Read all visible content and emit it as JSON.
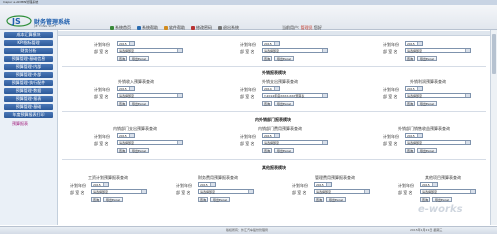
{
  "window": {
    "title": "Inspur e-ADMIN管理系统"
  },
  "app": {
    "logo_text": "财务管理系统",
    "logo_sub": "JIE TONG SOFT"
  },
  "topnav": [
    {
      "label": "系统首页",
      "color": "#3a8a3a"
    },
    {
      "label": "系统帮助",
      "color": "#2b6cb0"
    },
    {
      "label": "软件帮助",
      "color": "#d18b1f"
    },
    {
      "label": "修改密码",
      "color": "#b83232"
    },
    {
      "label": "退出系统",
      "color": "#777777"
    }
  ],
  "user": {
    "greeting": "当前用户:",
    "name": "管理员",
    "role": "您好"
  },
  "sidebar": {
    "items": [
      {
        "label": "成本汇算模块"
      },
      {
        "label": "KPI指标管理"
      },
      {
        "label": "财务分析"
      },
      {
        "label": "预算管理-基础信息"
      },
      {
        "label": "预算管理-内部"
      },
      {
        "label": "预算管理-外部"
      },
      {
        "label": "预算管理-执行配件"
      },
      {
        "label": "预算管理-数据"
      },
      {
        "label": "预算管理-报表"
      },
      {
        "label": "预算管理-基础"
      },
      {
        "label": "年度预算报表打印"
      },
      {
        "label": "预算报表"
      }
    ]
  },
  "form": {
    "year_label": "计划年份",
    "dept_label": "部 室 名",
    "year_value": "2015",
    "year_value_alt": "2014",
    "dept_placeholder": "请选择部室",
    "dept_value_alt": "Y-2014年度XXXX-XXX预算表",
    "query_btn": "查询",
    "export_btn": "导出Excel"
  },
  "sections": {
    "s1_panels": [
      "",
      "",
      ""
    ],
    "s2_title": "外销报表模块",
    "s2_panels": [
      "外销收入预算表查询",
      "外销支出预算表查询",
      "外销利润预算表查询"
    ],
    "s3_title": "内外销部门报表模块",
    "s3_panels": [
      "内销部门支出预算表查询",
      "内销部门费用预算表查询",
      "外销部门销售收益预算表查询"
    ],
    "s4_title": "其他报表模块",
    "s4_panels": [
      "工资计划预算报表查询",
      "财务费用预算报表查询",
      "管理费用预算报表查询",
      "其他项目预算表查询"
    ]
  },
  "footer": {
    "copy": "版权所有：外汇汽车股份管理局",
    "date": "2015年1月21日 星期三"
  },
  "watermark": "e-works"
}
